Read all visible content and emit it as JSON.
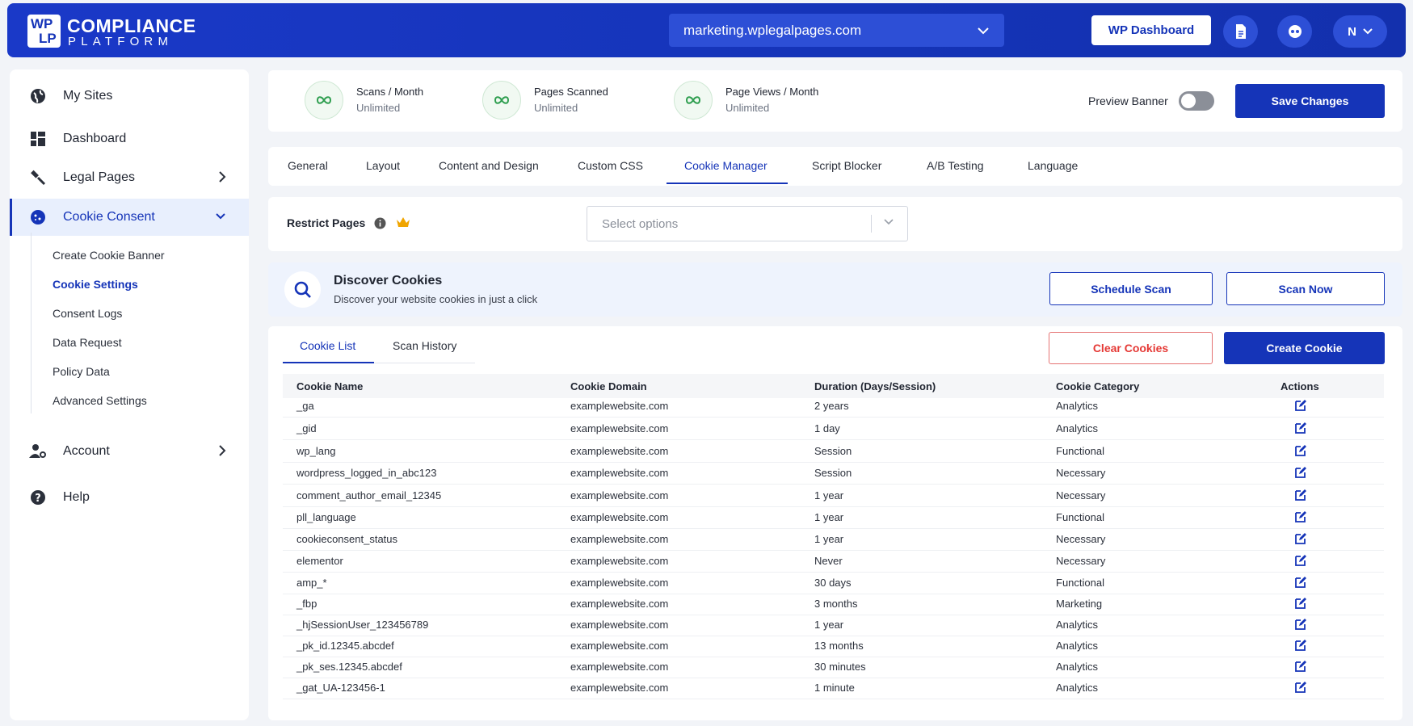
{
  "header": {
    "logo_mark_top": "WP",
    "logo_mark_bottom": "LP",
    "logo_title": "COMPLIANCE",
    "logo_subtitle": "PLATFORM",
    "site_selector": "marketing.wplegalpages.com",
    "wp_dashboard_label": "WP Dashboard",
    "user_initial": "N"
  },
  "sidebar": {
    "items": [
      {
        "label": "My Sites",
        "icon": "globe-icon"
      },
      {
        "label": "Dashboard",
        "icon": "dashboard-icon"
      },
      {
        "label": "Legal Pages",
        "icon": "gavel-icon"
      },
      {
        "label": "Cookie Consent",
        "icon": "cookie-icon"
      },
      {
        "label": "Account",
        "icon": "user-gear-icon"
      },
      {
        "label": "Help",
        "icon": "help-icon"
      }
    ],
    "sub_items": [
      "Create Cookie Banner",
      "Cookie Settings",
      "Consent Logs",
      "Data Request",
      "Policy Data",
      "Advanced Settings"
    ]
  },
  "stats": [
    {
      "label": "Scans / Month",
      "value": "Unlimited"
    },
    {
      "label": "Pages Scanned",
      "value": "Unlimited"
    },
    {
      "label": "Page Views / Month",
      "value": "Unlimited"
    }
  ],
  "preview_banner_label": "Preview Banner",
  "save_changes_label": "Save Changes",
  "tabs": [
    "General",
    "Layout",
    "Content and Design",
    "Custom CSS",
    "Cookie Manager",
    "Script Blocker",
    "A/B Testing",
    "Language"
  ],
  "restrict_pages": {
    "label": "Restrict Pages",
    "placeholder": "Select options"
  },
  "discover": {
    "title": "Discover Cookies",
    "subtitle": "Discover your website cookies in just a click",
    "schedule_label": "Schedule Scan",
    "scan_now_label": "Scan Now"
  },
  "cookie_tabs": [
    "Cookie List",
    "Scan History"
  ],
  "clear_cookies_label": "Clear Cookies",
  "create_cookie_label": "Create Cookie",
  "table": {
    "headers": [
      "Cookie Name",
      "Cookie Domain",
      "Duration (Days/Session)",
      "Cookie Category",
      "Actions"
    ],
    "rows": [
      [
        "_ga",
        "examplewebsite.com",
        "2 years",
        "Analytics"
      ],
      [
        "_gid",
        "examplewebsite.com",
        "1 day",
        "Analytics"
      ],
      [
        "wp_lang",
        "examplewebsite.com",
        "Session",
        "Functional"
      ],
      [
        "wordpress_logged_in_abc123",
        "examplewebsite.com",
        "Session",
        "Necessary"
      ],
      [
        "comment_author_email_12345",
        "examplewebsite.com",
        "1 year",
        "Necessary"
      ],
      [
        "pll_language",
        "examplewebsite.com",
        "1 year",
        "Functional"
      ],
      [
        "cookieconsent_status",
        "examplewebsite.com",
        "1 year",
        "Necessary"
      ],
      [
        "elementor",
        "examplewebsite.com",
        "Never",
        "Necessary"
      ],
      [
        "amp_*",
        "examplewebsite.com",
        "30 days",
        "Functional"
      ],
      [
        "_fbp",
        "examplewebsite.com",
        "3 months",
        "Marketing"
      ],
      [
        "_hjSessionUser_123456789",
        "examplewebsite.com",
        "1 year",
        "Analytics"
      ],
      [
        "_pk_id.12345.abcdef",
        "examplewebsite.com",
        "13 months",
        "Analytics"
      ],
      [
        "_pk_ses.12345.abcdef",
        "examplewebsite.com",
        "30 minutes",
        "Analytics"
      ],
      [
        "_gat_UA-123456-1",
        "examplewebsite.com",
        "1 minute",
        "Analytics"
      ]
    ]
  },
  "colors": {
    "brand": "#1534b8",
    "danger": "#e53935",
    "stat_icon": "#2e9e4f",
    "premium": "#f0a500"
  }
}
